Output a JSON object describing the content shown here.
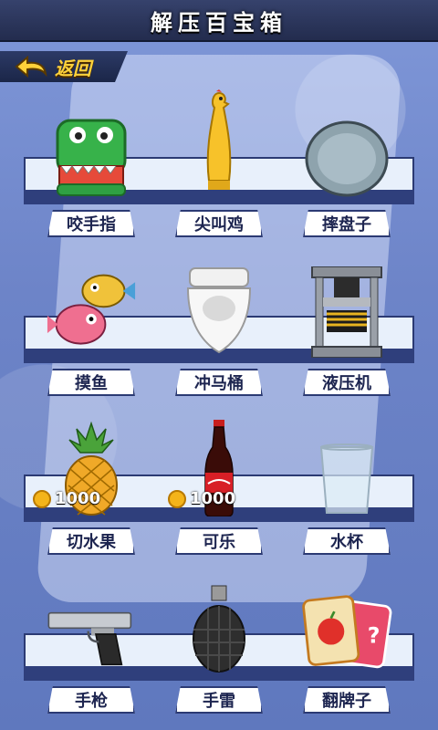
{
  "header": {
    "title": "解压百宝箱"
  },
  "back_button": {
    "label": "返回"
  },
  "items": [
    {
      "name": "咬手指",
      "icon": "crocodile-icon"
    },
    {
      "name": "尖叫鸡",
      "icon": "rubber-chicken-icon"
    },
    {
      "name": "摔盘子",
      "icon": "plate-icon"
    },
    {
      "name": "摸鱼",
      "icon": "fish-icon"
    },
    {
      "name": "冲马桶",
      "icon": "toilet-icon"
    },
    {
      "name": "液压机",
      "icon": "hydraulic-press-icon"
    },
    {
      "name": "切水果",
      "icon": "pineapple-icon",
      "price": "1000"
    },
    {
      "name": "可乐",
      "icon": "cola-bottle-icon",
      "price": "1000"
    },
    {
      "name": "水杯",
      "icon": "water-glass-icon"
    },
    {
      "name": "手枪",
      "icon": "pistol-icon"
    },
    {
      "name": "手雷",
      "icon": "grenade-icon"
    },
    {
      "name": "翻牌子",
      "icon": "flip-cards-icon"
    }
  ]
}
